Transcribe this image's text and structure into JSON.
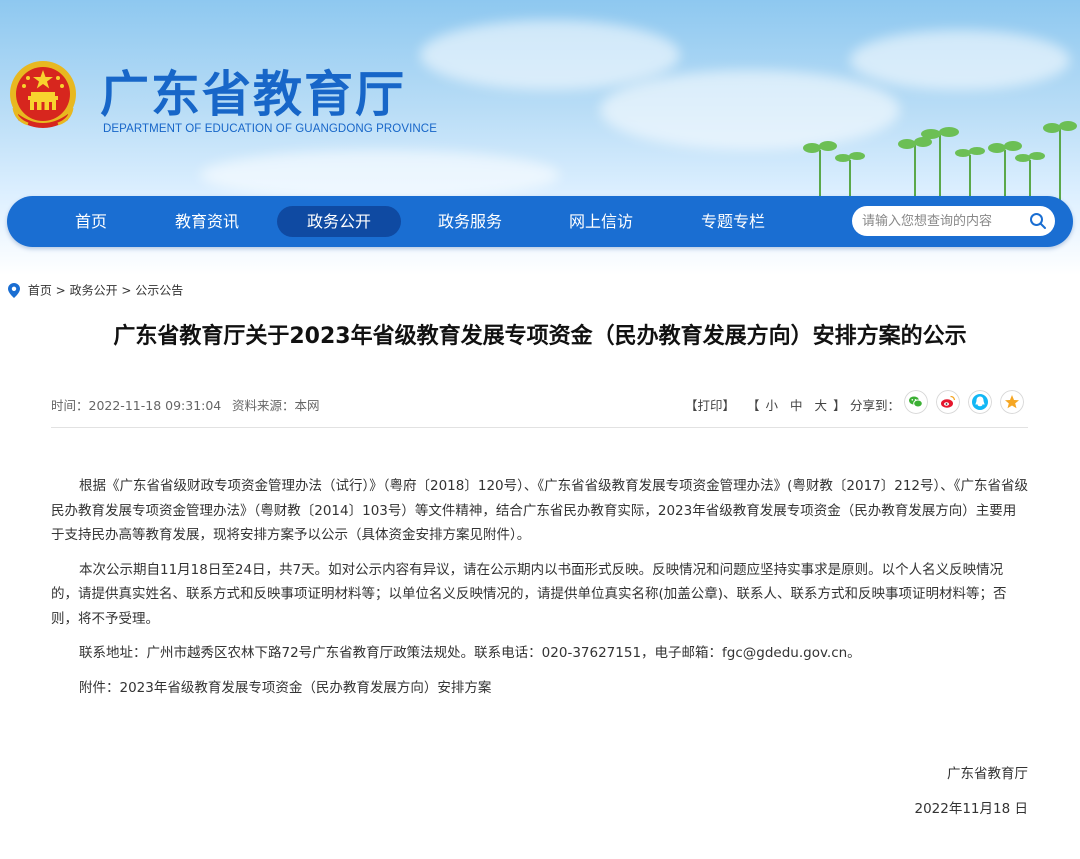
{
  "header": {
    "title": "广东省教育厅",
    "subtitle": "DEPARTMENT OF EDUCATION OF GUANGDONG PROVINCE"
  },
  "nav": {
    "items": [
      {
        "label": "首页"
      },
      {
        "label": "教育资讯"
      },
      {
        "label": "政务公开"
      },
      {
        "label": "政务服务"
      },
      {
        "label": "网上信访"
      },
      {
        "label": "专题专栏"
      }
    ],
    "active_index": 2,
    "search_placeholder": "请输入您想查询的内容"
  },
  "breadcrumb": {
    "items": [
      "首页",
      "政务公开",
      "公示公告"
    ],
    "separator": ">"
  },
  "article": {
    "title": "广东省教育厅关于2023年省级教育发展专项资金（民办教育发展方向）安排方案的公示",
    "time": "时间：2022-11-18 09:31:04",
    "source": "资料来源：本网",
    "print_label": "【打印】",
    "size_open": "【",
    "size_small": "小",
    "size_medium": "中",
    "size_large": "大",
    "size_close": "】",
    "share_label": "分享到：",
    "paragraphs": [
      "根据《广东省省级财政专项资金管理办法（试行）》（粤府〔2018〕120号）、《广东省省级教育发展专项资金管理办法》(粤财教〔2017〕212号）、《广东省省级民办教育发展专项资金管理办法》（粤财教〔2014〕103号）等文件精神，结合广东省民办教育实际，2023年省级教育发展专项资金（民办教育发展方向）主要用于支持民办高等教育发展，现将安排方案予以公示（具体资金安排方案见附件）。",
      "本次公示期自11月18日至24日，共7天。如对公示内容有异议，请在公示期内以书面形式反映。反映情况和问题应坚持实事求是原则。以个人名义反映情况的，请提供真实姓名、联系方式和反映事项证明材料等；以单位名义反映情况的，请提供单位真实名称(加盖公章)、联系人、联系方式和反映事项证明材料等；否则，将不予受理。",
      "联系地址：广州市越秀区农林下路72号广东省教育厅政策法规处。联系电话：020-37627151，电子邮箱：fgc@gdedu.gov.cn。",
      "附件：2023年省级教育发展专项资金（民办教育发展方向）安排方案"
    ],
    "signature": "广东省教育厅",
    "date": "2022年11月18 日"
  },
  "colors": {
    "brand_blue": "#1766c8",
    "nav_bg": "#1a6ed2",
    "nav_active": "#0f4aa2",
    "wechat": "#3cb034",
    "weibo": "#e6162d",
    "qq": "#12b7f5",
    "qzone": "#f5a623"
  },
  "icons": [
    "national-emblem-icon",
    "location-icon",
    "search-icon",
    "wechat-icon",
    "weibo-icon",
    "qq-icon",
    "qzone-icon"
  ]
}
